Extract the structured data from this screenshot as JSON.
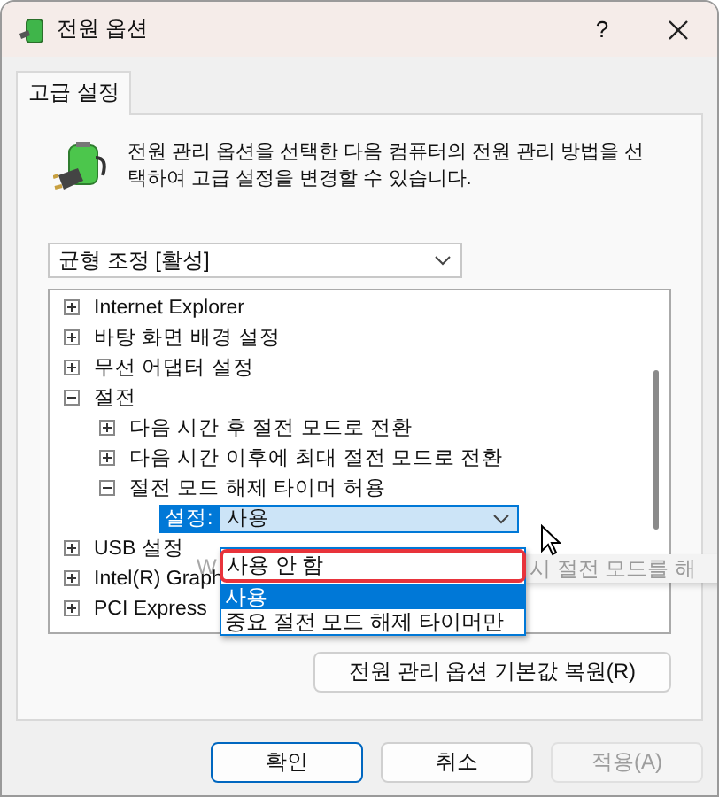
{
  "window": {
    "title": "전원 옵션",
    "help": "?"
  },
  "tabs": [
    {
      "label": "고급 설정",
      "selected": true
    }
  ],
  "description": "전원 관리 옵션을 선택한 다음 컴퓨터의 전원 관리 방법을 선택하여 고급 설정을 변경할 수 있습니다.",
  "plan_select": {
    "value": "균형 조정 [활성]"
  },
  "tree": [
    {
      "label": "Internet Explorer",
      "expanded": false
    },
    {
      "label": "바탕 화면 배경 설정",
      "expanded": false
    },
    {
      "label": "무선 어댑터 설정",
      "expanded": false
    },
    {
      "label": "절전",
      "expanded": true,
      "children": [
        {
          "label": "다음 시간 후 절전 모드로 전환",
          "expanded": false
        },
        {
          "label": "다음 시간 이후에 최대 절전 모드로 전환",
          "expanded": false
        },
        {
          "label": "절전 모드 해제 타이머 허용",
          "expanded": true,
          "children": [
            {
              "kind": "setting",
              "label": "설정:",
              "value": "사용"
            }
          ]
        }
      ]
    },
    {
      "label": "USB 설정",
      "expanded": false
    },
    {
      "label": "Intel(R) Graph",
      "expanded": false
    },
    {
      "label": "PCI Express",
      "expanded": false
    }
  ],
  "tooltip": [
    "W",
    "시 절전 모드를 해"
  ],
  "dropdown_options": [
    {
      "label": "사용 안 함",
      "selected": false,
      "marked": true
    },
    {
      "label": "사용",
      "selected": true,
      "marked": false
    },
    {
      "label": "중요 절전 모드 해제 타이머만",
      "selected": false,
      "marked": false
    }
  ],
  "restore_button": "전원 관리 옵션 기본값 복원(R)",
  "buttons": [
    {
      "label": "확인",
      "default": true,
      "disabled": false
    },
    {
      "label": "취소",
      "default": false,
      "disabled": false
    },
    {
      "label": "적용(A)",
      "default": false,
      "disabled": true
    }
  ]
}
